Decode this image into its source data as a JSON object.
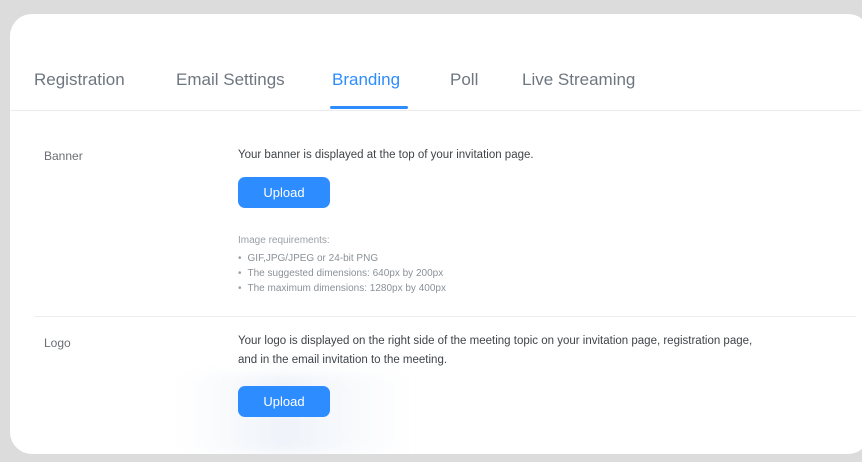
{
  "tabs": [
    {
      "label": "Registration",
      "active": false
    },
    {
      "label": "Email Settings",
      "active": false
    },
    {
      "label": "Branding",
      "active": true
    },
    {
      "label": "Poll",
      "active": false
    },
    {
      "label": "Live Streaming",
      "active": false
    }
  ],
  "banner": {
    "label": "Banner",
    "description": "Your banner is displayed at the top of your invitation page.",
    "upload_label": "Upload",
    "requirements_title": "Image requirements:",
    "requirements": [
      "GIF,JPG/JPEG or 24-bit PNG",
      "The suggested dimensions: 640px by 200px",
      "The maximum dimensions: 1280px by 400px"
    ]
  },
  "logo": {
    "label": "Logo",
    "description_line1": "Your logo is displayed on the right side of the meeting topic on your invitation page, registration page,",
    "description_line2": "and in the email invitation to the meeting.",
    "upload_label": "Upload"
  },
  "colors": {
    "accent": "#2d8cff",
    "background": "#dcdcdc",
    "card": "#ffffff"
  }
}
